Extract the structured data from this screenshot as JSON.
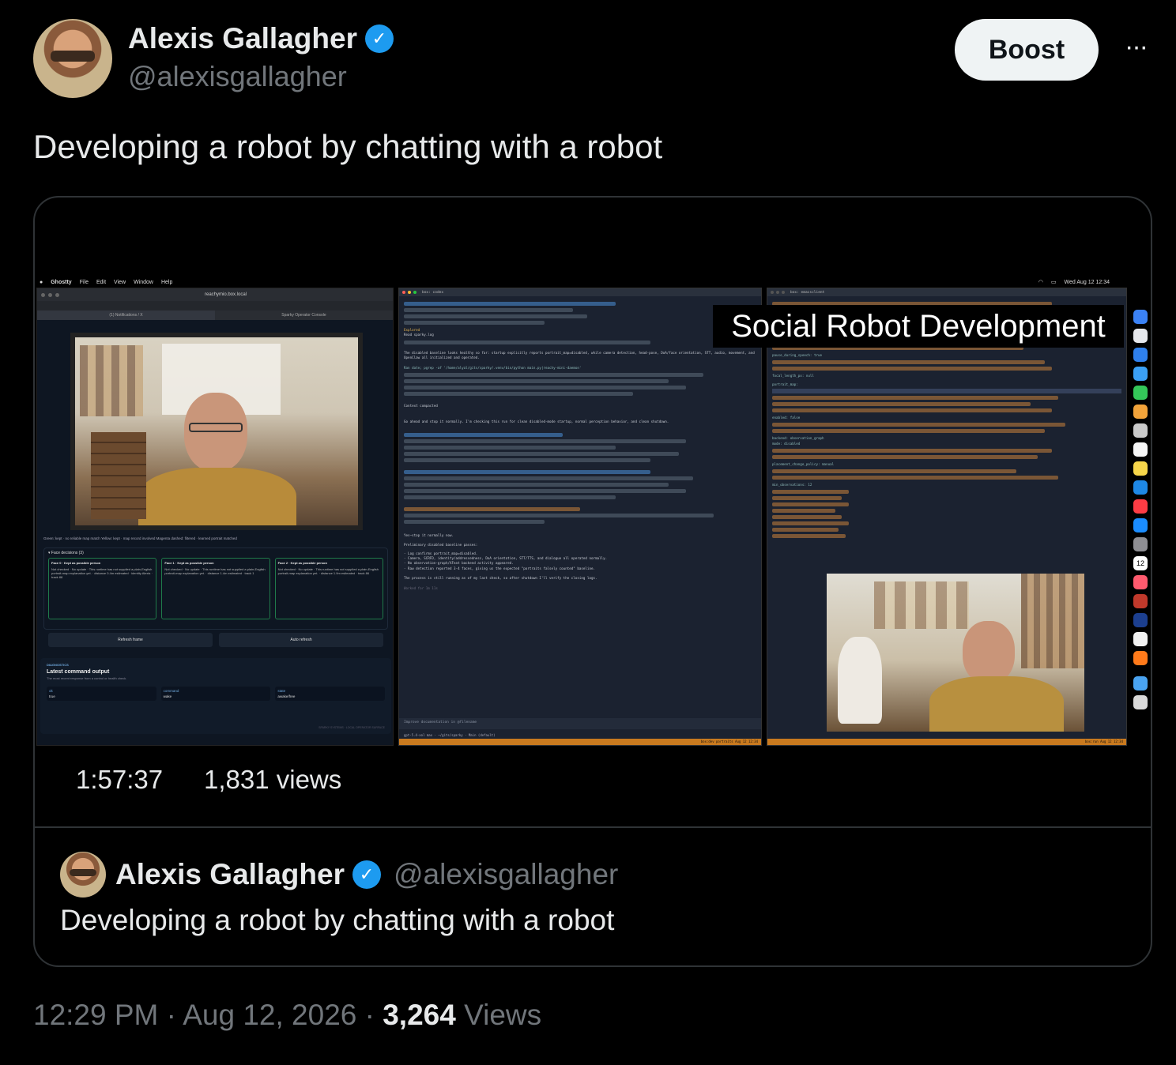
{
  "post": {
    "author_name": "Alexis Gallagher",
    "author_handle": "@alexisgallagher",
    "boost_label": "Boost",
    "more_label": "···",
    "text": "Developing a robot by chatting with a robot",
    "timestamp": "12:29 PM · Aug 12, 2026 · ",
    "views_count": "3,264",
    "views_label": " Views"
  },
  "video": {
    "overlay_title": "Social Robot Development",
    "duration": "1:57:37",
    "views": "1,831 views",
    "menubar": {
      "app": "Ghostty",
      "items": [
        "File",
        "Edit",
        "View",
        "Window",
        "Help"
      ],
      "clock": "Wed Aug 12 12:34"
    },
    "browser": {
      "url": "reachymio.box.local",
      "tab_left": "(1) Notifications / X",
      "tab_right": "Sparky Operator Console",
      "legend": "Green: kept · no reliable map match    Yellow: kept · map record involved    Magenta dashed: filtered · learned portrait matched",
      "face_decisions_title": "▾ Face decisions (3)",
      "faces": [
        {
          "title": "Face 0 · Kept as possible person",
          "text": "Not checked · No update · This runtime has not supplied a plain-English portrait-map explanation yet. · distance 0.4m estimated · identity Alexis · track 88"
        },
        {
          "title": "Face 1 · Kept as possible person",
          "text": "Not checked · No update · This runtime has not supplied a plain-English portrait-map explanation yet. · distance 1.4m estimated · track 1"
        },
        {
          "title": "Face 2 · Kept as possible person",
          "text": "Not checked · No update · This runtime has not supplied a plain-English portrait-map explanation yet. · distance 1.9m estimated · track 86"
        }
      ],
      "refresh_label": "Refresh frame",
      "auto_label": "Auto refresh",
      "diagnostics_label": "DIAGNOSTICS",
      "latest_title": "Latest command output",
      "latest_sub": "The most recent response from a control or health check.",
      "fields": [
        {
          "key": "ok",
          "value": "true"
        },
        {
          "key": "command",
          "value": "wake"
        },
        {
          "key": "state",
          "value": "awake/free"
        }
      ],
      "footer": "SPARKY SYSTEMS · LOCAL OPERATOR SURFACE"
    },
    "terminal_codex": {
      "title": "box: codex",
      "lines": [
        "Explored",
        "Read sparky.log",
        "The disabled baseline looks healthy so far: startup explicitly reports portrait_map=disabled, while camera detection, head-pose, DoA/face orientation, STT, audio, movement, and OpenClaw all initialized and operated.",
        "Ran date; pgrep -af '/home/alyal/gits/sparky/.venv/bin/python main.py|reachy-mini-daemon'",
        "Context compacted",
        "Go ahead and stop it normally. I'm checking this run for clean disabled-mode startup, normal perception behavior, and clean shutdown.",
        "Yes—stop it normally now.",
        "Preliminary disabled baseline passes:",
        "- Log confirms portrait_map=disabled.",
        "- Camera, SCRFD, identity/addressedness, DoA orientation, STT/TTS, and dialogue all operated normally.",
        "- No observation-graph/XFeat backend activity appeared.",
        "- Raw detection reported 3-4 faces, giving us the expected \"portraits falsely counted\" baseline.",
        "The process is still running as of my last check, so after shutdown I'll verify the closing logs.",
        "Worked for 1m 11s"
      ],
      "prompt": "Improve documentation in @filename",
      "status": "gpt-5.4-xol max · ~/gits/sparky · Main (default)",
      "statusbar": "box:dev portraits  Aug 12  12:34"
    },
    "terminal_emacs": {
      "title": "box: emacsclient",
      "yaml_keys": [
        "pause_during_speech: true",
        "focal_length_px: null",
        "portrait_map:",
        "enabled: false",
        "backend: observation_graph",
        "mode: disabled",
        "placement_change_policy: manual",
        "min_observations: 12"
      ],
      "statusbar": "box:run  Aug 12  12:34"
    },
    "dock_day": "12"
  },
  "quoted": {
    "author_name": "Alexis Gallagher",
    "author_handle": "@alexisgallagher",
    "text": "Developing a robot by chatting with a robot"
  },
  "colors": {
    "background": "#000000",
    "text": "#e7e9ea",
    "secondary": "#71767b",
    "verified": "#1d9bf0",
    "border": "#2f3336",
    "boost_bg": "#eff3f4"
  },
  "icons": [
    "verified-badge-icon",
    "more-icon",
    "apple-logo-icon",
    "wifi-icon",
    "battery-icon",
    "search-icon"
  ]
}
